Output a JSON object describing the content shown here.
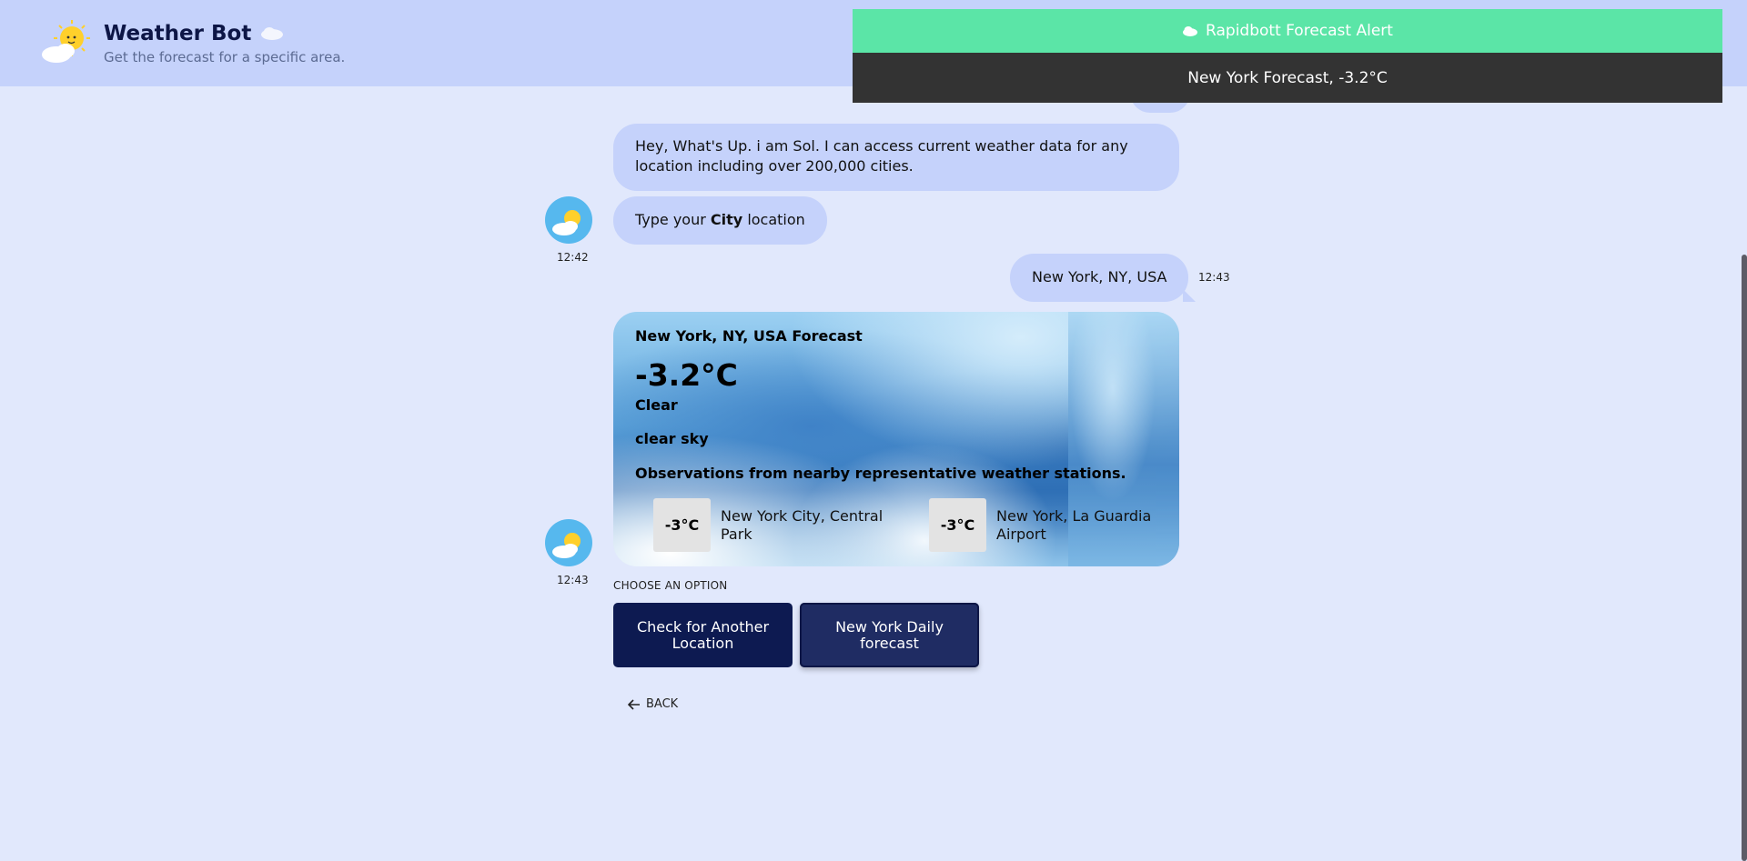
{
  "header": {
    "title": "Weather Bot",
    "subtitle": "Get the forecast for a specific area.",
    "logo_icon": "sun-cloud-icon",
    "title_icon": "cloud-icon"
  },
  "alert": {
    "title": "Rapidbott Forecast Alert",
    "message": "New York Forecast, -3.2°C",
    "icon": "cloud-icon"
  },
  "chat": {
    "intro": "Hey, What's Up. i am Sol. I can access current weather data for any location including over 200,000 cities.",
    "prompt_prefix": "Type your",
    "prompt_bold": "City",
    "prompt_suffix": "location",
    "prompt_time": "12:42",
    "user_message": "New York, NY, USA",
    "user_time": "12:43",
    "card_time": "12:43"
  },
  "forecast": {
    "title": "New York, NY, USA Forecast",
    "temperature": "-3.2°C",
    "condition": "Clear",
    "description": "clear sky",
    "observations_label": "Observations from nearby representative weather stations.",
    "stations": [
      {
        "temp": "-3°C",
        "name": "New York City, Central Park"
      },
      {
        "temp": "-3°C",
        "name": "New York, La Guardia Airport"
      }
    ]
  },
  "options": {
    "label": "CHOOSE AN OPTION",
    "buttons": [
      {
        "label": "Check for Another Location"
      },
      {
        "label": "New York Daily forecast"
      }
    ]
  },
  "back": {
    "label": "BACK",
    "icon": "arrow-left-icon"
  },
  "colors": {
    "header_bg": "#c5d2fb",
    "page_bg": "#e1e8fc",
    "alert_green": "#5be5a7",
    "alert_dark": "#333333",
    "button_navy": "#0d1a51"
  }
}
